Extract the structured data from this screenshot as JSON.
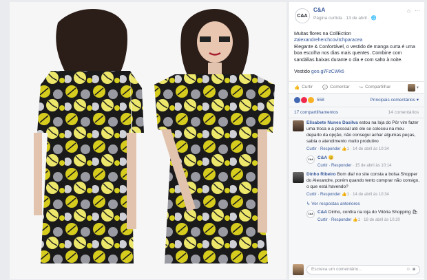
{
  "page": {
    "name": "C&A",
    "logo_text": "C&A",
    "meta": "Página curtida · 13 de abril · 🌐"
  },
  "post": {
    "line1": "Muitas flores na CollEction",
    "hashtag": "#alexandreherchcovitchparacea",
    "text": "Elegante & Confortável, o vestido de manga curta é uma boa escolha nos dias mais quentes. Combine com sandálias baixas durante o dia e com salto à noite.",
    "vestido_label": "Vestido goo.gl/FzCWk6",
    "vestido_prefix": "Vestido ",
    "vestido_link": "goo.gl/FzCWk6"
  },
  "actions": {
    "like": "Curtir",
    "comment": "Comentar",
    "share": "Compartilhar"
  },
  "stats": {
    "reactions_count": "558",
    "order": "Principais comentários ▾",
    "shares": "17 compartilhamentos",
    "comments": "14 comentários"
  },
  "comments": [
    {
      "author": "Elisabete Nunes Dasilva",
      "text": "estou na loja do Pôr vim fazer uma troca e a pessoal até ele se colocou na meu departo da opção, não consegui achar algumas peças, sabia o atendimento muito produtivo",
      "reply": "Curtir · Responder",
      "likes": "👍1 · 14 de abril às 10:34"
    },
    {
      "author": "C&A",
      "text": "😊",
      "reply": "Curtir · Responder",
      "likes": "· 15 de abril às 10:14"
    },
    {
      "author": "Dinho Ribeiro",
      "text": "Bom dia! no site consta a bolsa Shopper do Alexandre, porém quando tento comprar não consigo, o que está havendo?",
      "reply": "Curtir · Responder",
      "likes": "👍1 · 14 de abril às 10:34"
    },
    {
      "see_replies": "↳ Ver respostas anteriores"
    },
    {
      "author": "C&A",
      "text": "Dinho, confira na loja do Vitória Shopping 🛍",
      "reply": "Curtir · Responder",
      "likes": "👍1 · 18 de abril às 10:20"
    }
  ],
  "write": {
    "placeholder": "Escreva um comentário..."
  },
  "colors": {
    "fb_blue": "#365899",
    "like_blue": "#4267b2",
    "dress_yellow": "#e0d020",
    "dress_dark": "#151515"
  }
}
